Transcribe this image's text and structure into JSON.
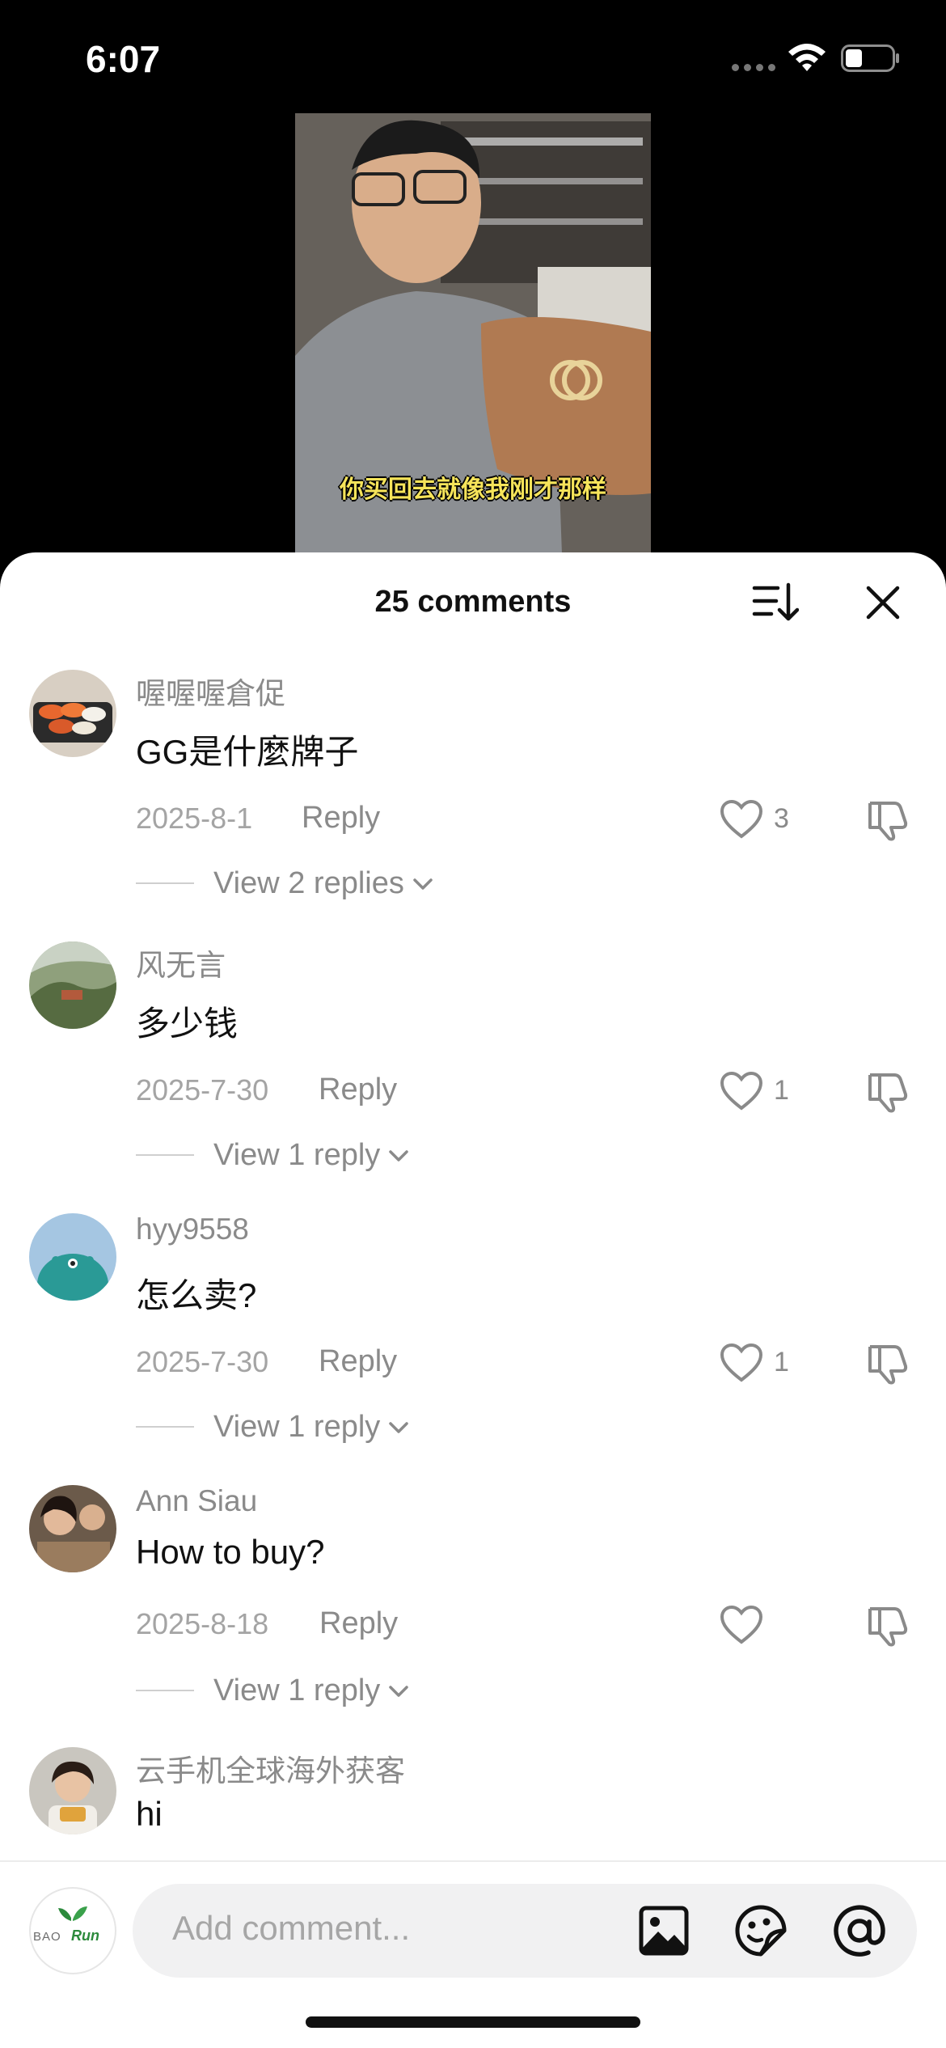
{
  "status_bar": {
    "time": "6:07"
  },
  "video": {
    "caption": "你买回去就像我刚才那样"
  },
  "sheet": {
    "title": "25 comments"
  },
  "comments": [
    {
      "user": "喔喔喔倉促",
      "text": "GG是什麼牌子",
      "date": "2025-8-1",
      "reply_label": "Reply",
      "likes": "3",
      "view_replies": "View 2 replies"
    },
    {
      "user": "风无言",
      "text": "多少钱",
      "date": "2025-7-30",
      "reply_label": "Reply",
      "likes": "1",
      "view_replies": "View 1 reply"
    },
    {
      "user": "hyy9558",
      "text": "怎么卖?",
      "date": "2025-7-30",
      "reply_label": "Reply",
      "likes": "1",
      "view_replies": "View 1 reply"
    },
    {
      "user": "Ann Siau",
      "text": "How to buy?",
      "date": "2025-8-18",
      "reply_label": "Reply",
      "likes": "",
      "view_replies": "View 1 reply"
    },
    {
      "user": "云手机全球海外获客",
      "text": "hi"
    }
  ],
  "composer": {
    "placeholder": "Add comment...",
    "avatar_logo_part1": "BAO",
    "avatar_logo_part2": "Run"
  },
  "icons": {
    "sort": "sort-icon",
    "close": "close-icon",
    "like": "heart-outline-icon",
    "dislike": "thumbs-down-icon",
    "image": "image-icon",
    "emoji": "sticker-emoji-icon",
    "mention": "at-mention-icon"
  },
  "colors": {
    "caption": "#f6e45a",
    "secondary_text": "#8a8a8a",
    "logo_green": "#2c8a3c"
  }
}
